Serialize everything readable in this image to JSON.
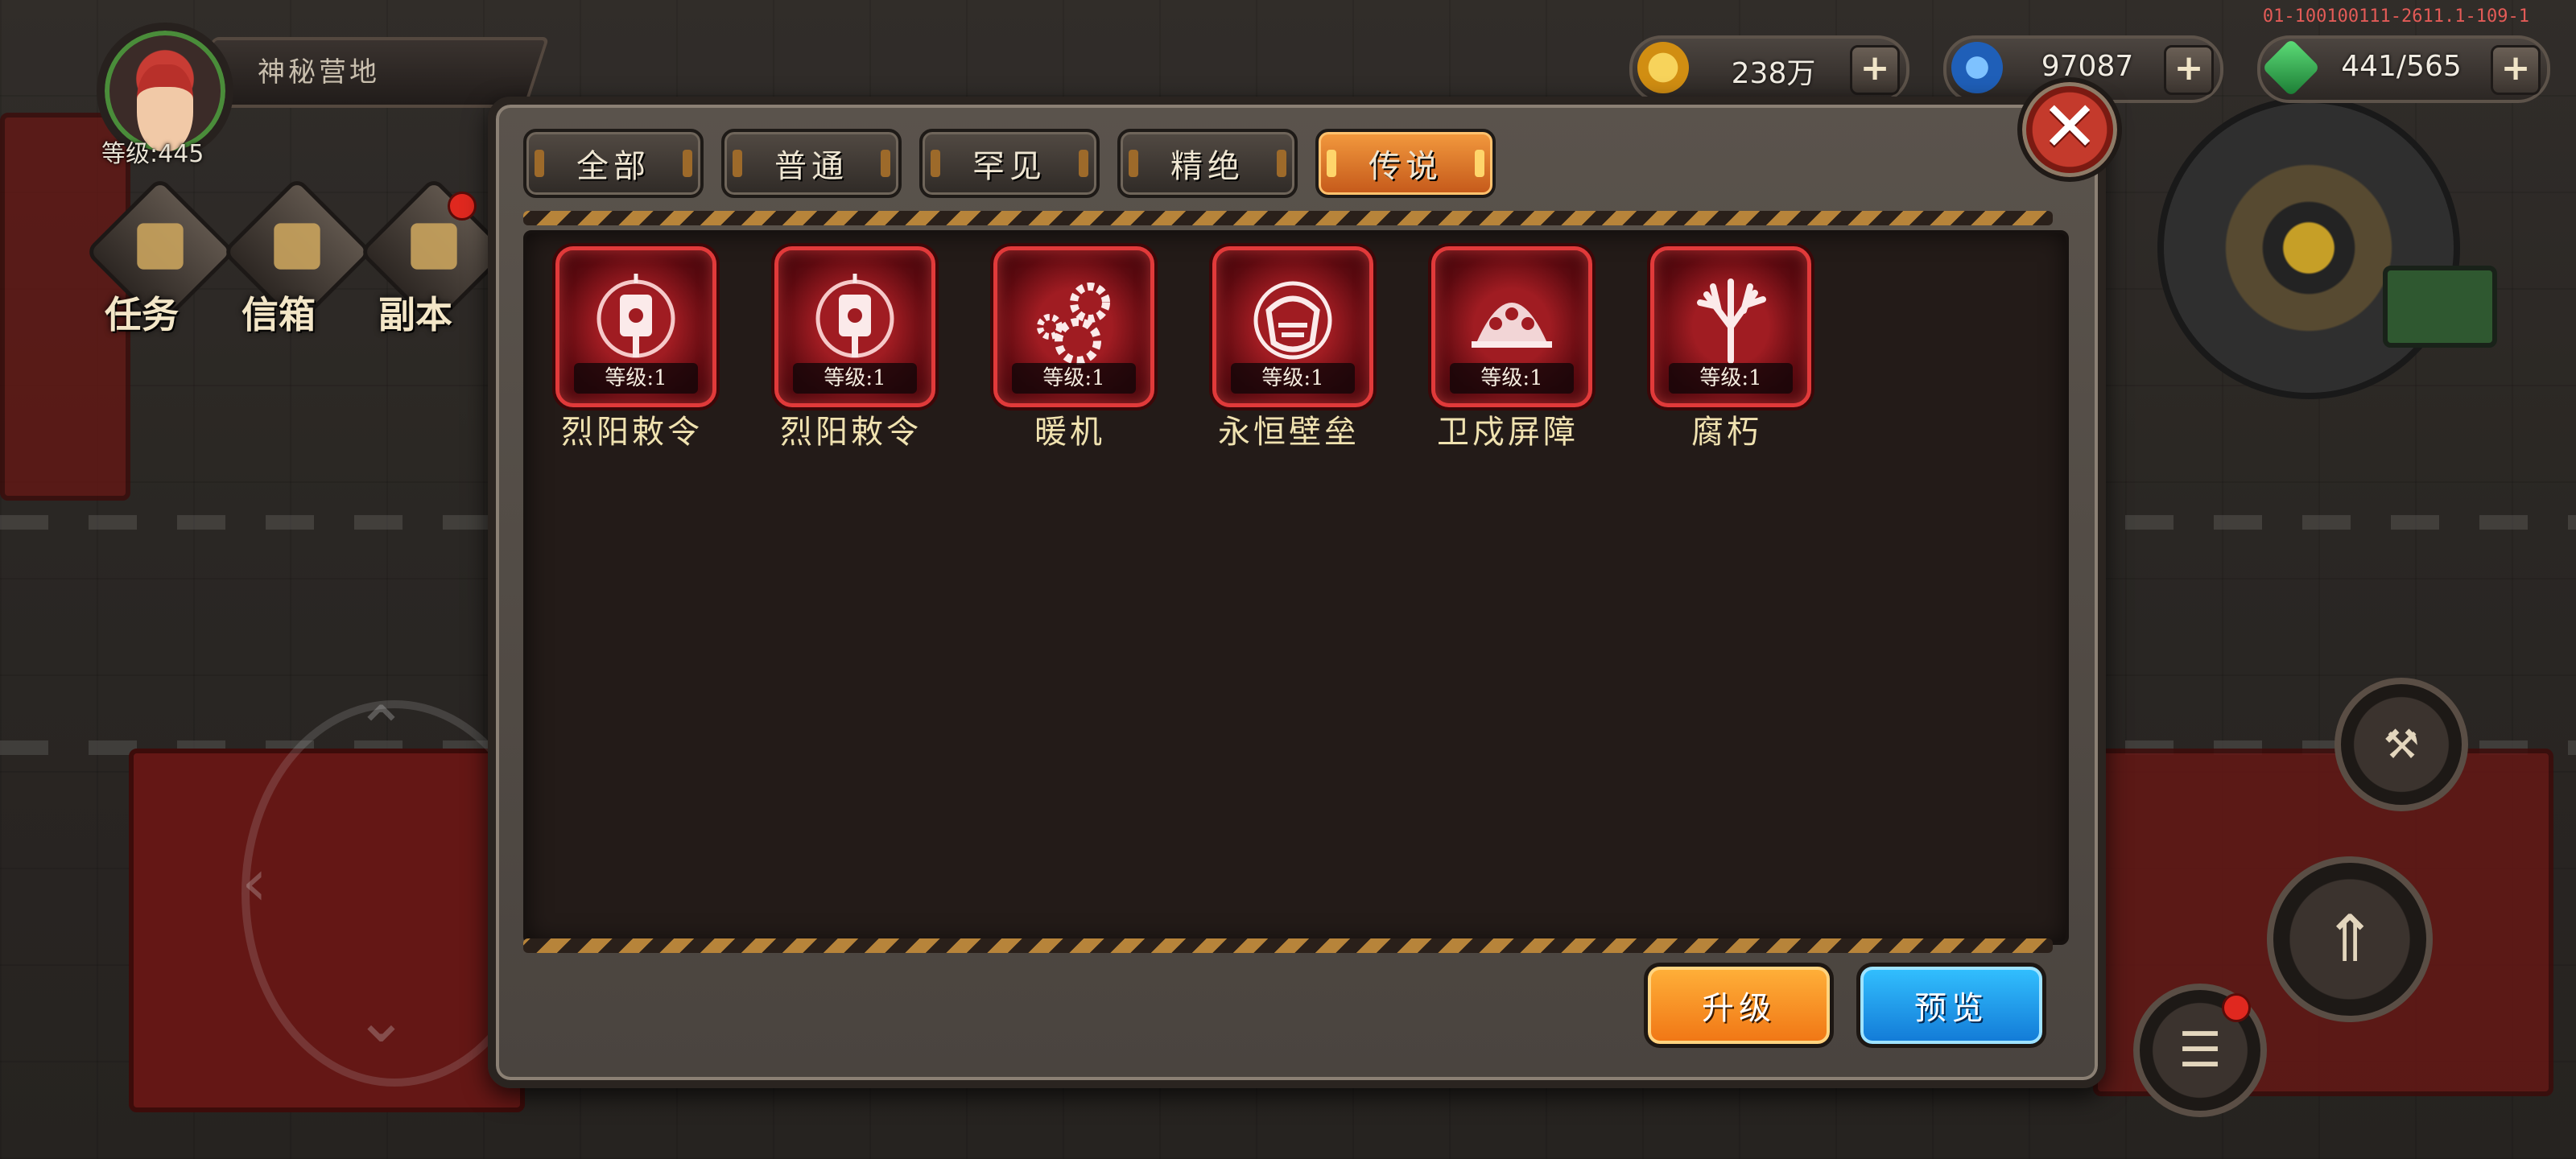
{
  "hud": {
    "location": "神秘营地",
    "level": "等级:445",
    "build_id": "01-100100111-2611.1-109-1",
    "side_buttons": [
      "任务",
      "信箱",
      "副本"
    ],
    "resources": [
      {
        "name": "gold-coin-icon",
        "value": "238万",
        "color": "#f2b51b"
      },
      {
        "name": "blue-gem-icon",
        "value": "97087",
        "color": "#2f7bd8"
      },
      {
        "name": "green-energy-icon",
        "value": "441/565",
        "color": "#2ea84a"
      }
    ]
  },
  "dialog": {
    "tabs": [
      {
        "label": "全部",
        "active": false
      },
      {
        "label": "普通",
        "active": false
      },
      {
        "label": "罕见",
        "active": false
      },
      {
        "label": "精绝",
        "active": false
      },
      {
        "label": "传说",
        "active": true
      }
    ],
    "items": [
      {
        "name": "烈阳敕令",
        "level": "等级:1",
        "icon": "lantern-seal-icon"
      },
      {
        "name": "烈阳敕令",
        "level": "等级:1",
        "icon": "lantern-seal-icon"
      },
      {
        "name": "暖机",
        "level": "等级:1",
        "icon": "gears-icon"
      },
      {
        "name": "永恒壁垒",
        "level": "等级:1",
        "icon": "shield-dome-icon"
      },
      {
        "name": "卫戍屏障",
        "level": "等级:1",
        "icon": "barrier-sphere-icon"
      },
      {
        "name": "腐朽",
        "level": "等级:1",
        "icon": "withered-tree-icon"
      }
    ],
    "buttons": {
      "upgrade": "升级",
      "preview": "预览"
    },
    "colors": {
      "active_tab": "#e57a2a",
      "item_frame": "#c0202a",
      "upgrade": "#f58a1f",
      "preview": "#1f9ae8"
    }
  }
}
